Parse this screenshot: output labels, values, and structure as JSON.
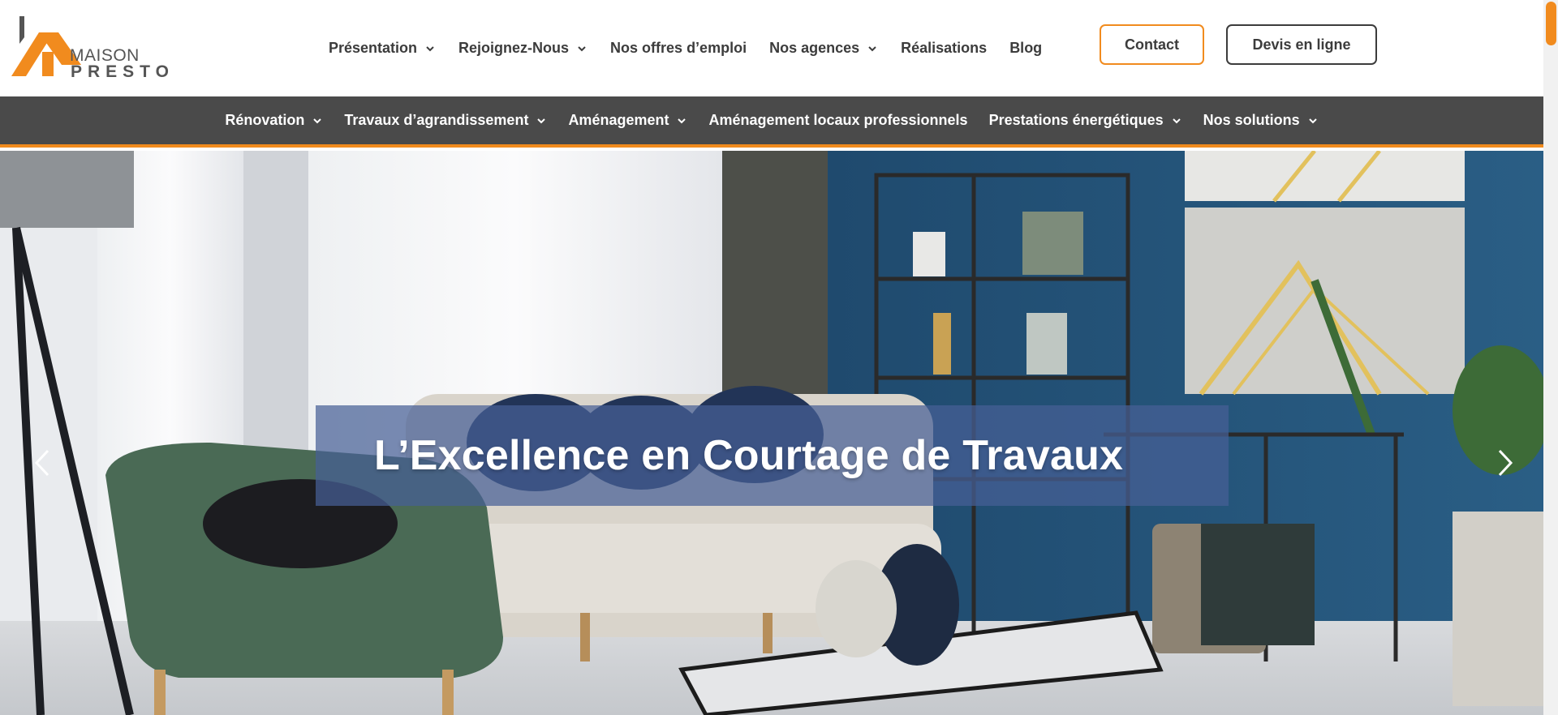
{
  "logo": {
    "line1": "MAISON",
    "line2": "PRESTO",
    "colors": {
      "orange": "#f18b1e",
      "gray": "#555555"
    }
  },
  "top_nav": {
    "items": [
      {
        "label": "Présentation",
        "has_dropdown": true
      },
      {
        "label": "Rejoignez-Nous",
        "has_dropdown": true
      },
      {
        "label": "Nos offres d’emploi",
        "has_dropdown": false
      },
      {
        "label": "Nos agences",
        "has_dropdown": true
      },
      {
        "label": "Réalisations",
        "has_dropdown": false
      },
      {
        "label": "Blog",
        "has_dropdown": false
      }
    ],
    "contact_label": "Contact",
    "devis_label": "Devis en ligne"
  },
  "sub_nav": {
    "items": [
      {
        "label": "Rénovation",
        "has_dropdown": true
      },
      {
        "label": "Travaux d’agrandissement",
        "has_dropdown": true
      },
      {
        "label": "Aménagement",
        "has_dropdown": true
      },
      {
        "label": "Aménagement locaux professionnels",
        "has_dropdown": false
      },
      {
        "label": "Prestations énergétiques",
        "has_dropdown": true
      },
      {
        "label": "Nos solutions",
        "has_dropdown": true
      }
    ]
  },
  "hero": {
    "title": "L’Excellence en Courtage de Travaux",
    "prev_icon": "chevron-left-icon",
    "next_icon": "chevron-right-icon"
  },
  "theme": {
    "accent": "#f18b1e",
    "dark": "#4a4a4a",
    "text": "#3c3c3c",
    "banner": "#465f96"
  }
}
